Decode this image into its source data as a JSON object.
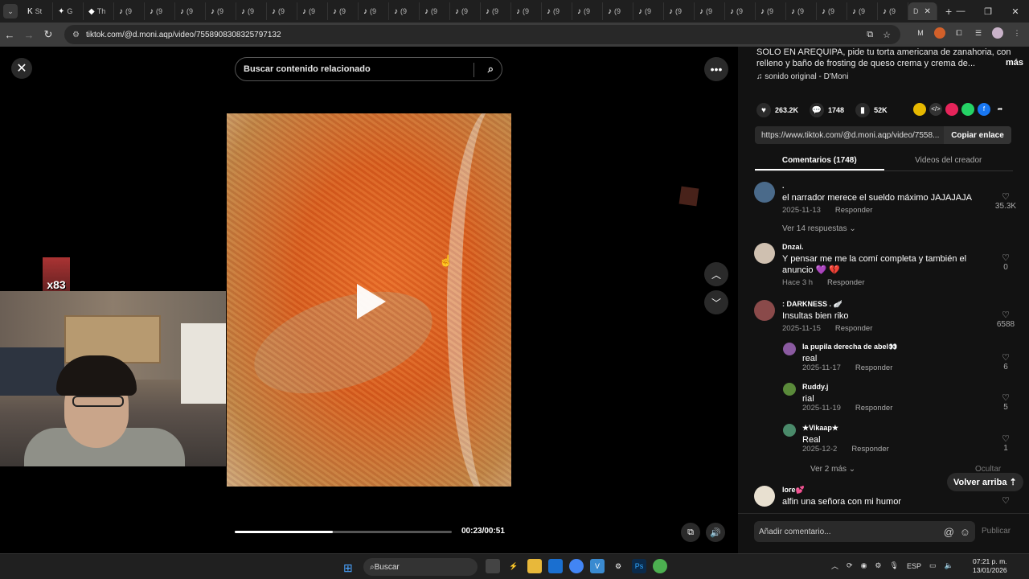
{
  "browser": {
    "tabs": [
      {
        "icon": "K",
        "label": "St"
      },
      {
        "icon": "✦",
        "label": "G"
      },
      {
        "icon": "◆",
        "label": "Th"
      },
      {
        "icon": "♪",
        "label": "(9"
      },
      {
        "icon": "♪",
        "label": "(9"
      },
      {
        "icon": "♪",
        "label": "(9"
      },
      {
        "icon": "♪",
        "label": "(9"
      },
      {
        "icon": "♪",
        "label": "(9"
      },
      {
        "icon": "♪",
        "label": "(9"
      },
      {
        "icon": "♪",
        "label": "(9"
      },
      {
        "icon": "♪",
        "label": "(9"
      },
      {
        "icon": "♪",
        "label": "(9"
      },
      {
        "icon": "♪",
        "label": "(9"
      },
      {
        "icon": "♪",
        "label": "(9"
      },
      {
        "icon": "♪",
        "label": "(9"
      },
      {
        "icon": "♪",
        "label": "(9"
      },
      {
        "icon": "♪",
        "label": "(9"
      },
      {
        "icon": "♪",
        "label": "(9"
      },
      {
        "icon": "♪",
        "label": "(9"
      },
      {
        "icon": "♪",
        "label": "(9"
      },
      {
        "icon": "♪",
        "label": "(9"
      },
      {
        "icon": "♪",
        "label": "(9"
      },
      {
        "icon": "♪",
        "label": "(9"
      },
      {
        "icon": "♪",
        "label": "(9"
      },
      {
        "icon": "♪",
        "label": "(9"
      },
      {
        "icon": "♪",
        "label": "(9"
      },
      {
        "icon": "♪",
        "label": "(9"
      },
      {
        "icon": "♪",
        "label": "(9"
      },
      {
        "icon": "♪",
        "label": "(9"
      }
    ],
    "active_tab_label": "D",
    "url": "tiktok.com/@d.moni.aqp/video/7558908308325797132"
  },
  "video": {
    "search_placeholder": "Buscar contenido relacionado",
    "time": "00:23/00:51",
    "progress": 0.45
  },
  "overlay": {
    "badge_text": "x83"
  },
  "panel": {
    "description": "SOLO EN AREQUIPA, pide tu torta americana de zanahoria, con relleno y baño de frosting de queso crema y crema de...",
    "more_label": "más",
    "sound": "sonido original - D'Moni",
    "likes": "263.2K",
    "comments_count": "1748",
    "saves": "52K",
    "link": "https://www.tiktok.com/@d.moni.aqp/video/7558...",
    "copy_label": "Copiar enlace",
    "tab_comments": "Comentarios (1748)",
    "tab_creator": "Videos del creador",
    "comments": [
      {
        "user": ".",
        "text": "el narrador merece el sueldo máximo JAJAJAJA",
        "date": "2025-11-13",
        "reply": "Responder",
        "likes": "35.3K",
        "color": "#4a6a8a"
      },
      {
        "user": "Dnzai.",
        "text": "Y pensar me me la comí completa y también el anuncio 💜 💔",
        "date": "Hace 3 h",
        "reply": "Responder",
        "likes": "0",
        "color": "#cfc0b0"
      },
      {
        "user": ": DARKNESS . 🪽",
        "text": "Insultas bien riko",
        "date": "2025-11-15",
        "reply": "Responder",
        "likes": "6588",
        "color": "#8a4a4a"
      },
      {
        "user": "la pupila derecha de abel👀",
        "text": "real",
        "date": "2025-11-17",
        "reply": "Responder",
        "likes": "6",
        "color": "#8a5aa0"
      },
      {
        "user": "Ruddy.j",
        "text": "rial",
        "date": "2025-11-19",
        "reply": "Responder",
        "likes": "5",
        "color": "#5a8a3a"
      },
      {
        "user": "★Vikaap★",
        "text": "Real",
        "date": "2025-12-2",
        "reply": "Responder",
        "likes": "1",
        "color": "#4a8a6a"
      },
      {
        "user": "lore💕",
        "text": "alfin una señora con mi humor",
        "date": "",
        "reply": "",
        "likes": "",
        "color": "#e8e0d0"
      }
    ],
    "see_replies": "Ver 14 respuestas ⌄",
    "see_more": "Ver 2 más ⌄",
    "hide_label": "Ocultar",
    "back_top": "Volver arriba ⇡",
    "comment_placeholder": "Añadir comentario...",
    "publish_label": "Publicar"
  },
  "taskbar": {
    "search_label": "Buscar",
    "lang": "ESP",
    "time": "07:21 p. m.",
    "date": "13/01/2026"
  }
}
